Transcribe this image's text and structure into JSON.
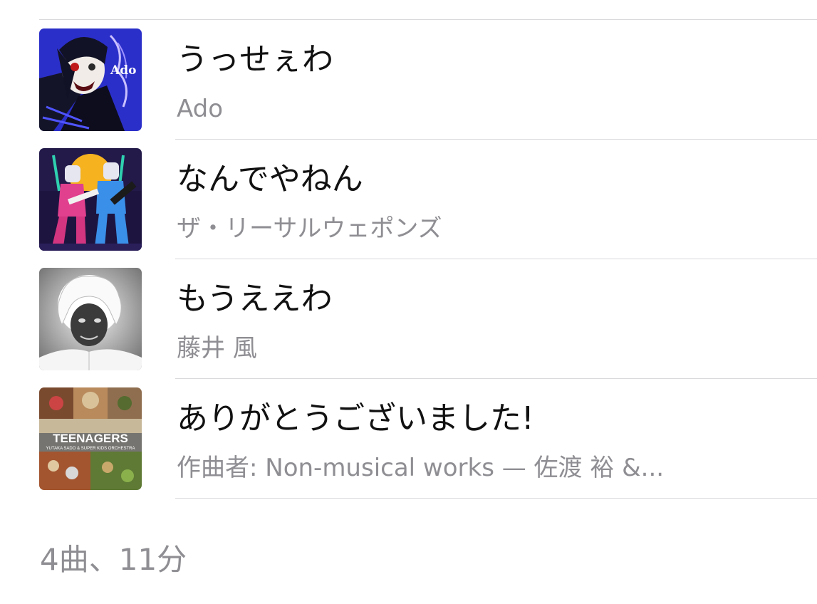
{
  "tracks": [
    {
      "title": "うっせぇわ",
      "artist": "Ado",
      "artwork": "ado-album-artwork",
      "artwork_text": "Ado"
    },
    {
      "title": "なんでやねん",
      "artist": "ザ・リーサルウェポンズ",
      "artwork": "lethal-weapons-album-artwork"
    },
    {
      "title": "もうええわ",
      "artist": "藤井 風",
      "artwork": "fujii-kaze-album-artwork"
    },
    {
      "title": "ありがとうございました!",
      "artist": "作曲者: Non-musical works — 佐渡 裕 &...",
      "artwork": "teenagers-album-artwork",
      "artwork_text": "TEENAGERS",
      "artwork_subtext": "YUTAKA SADO & SUPER KIDS ORCHESTRA"
    }
  ],
  "summary": "4曲、11分",
  "colors": {
    "title": "#111111",
    "secondary": "#8e8e93",
    "divider": "#d9d9dc",
    "background": "#ffffff"
  }
}
